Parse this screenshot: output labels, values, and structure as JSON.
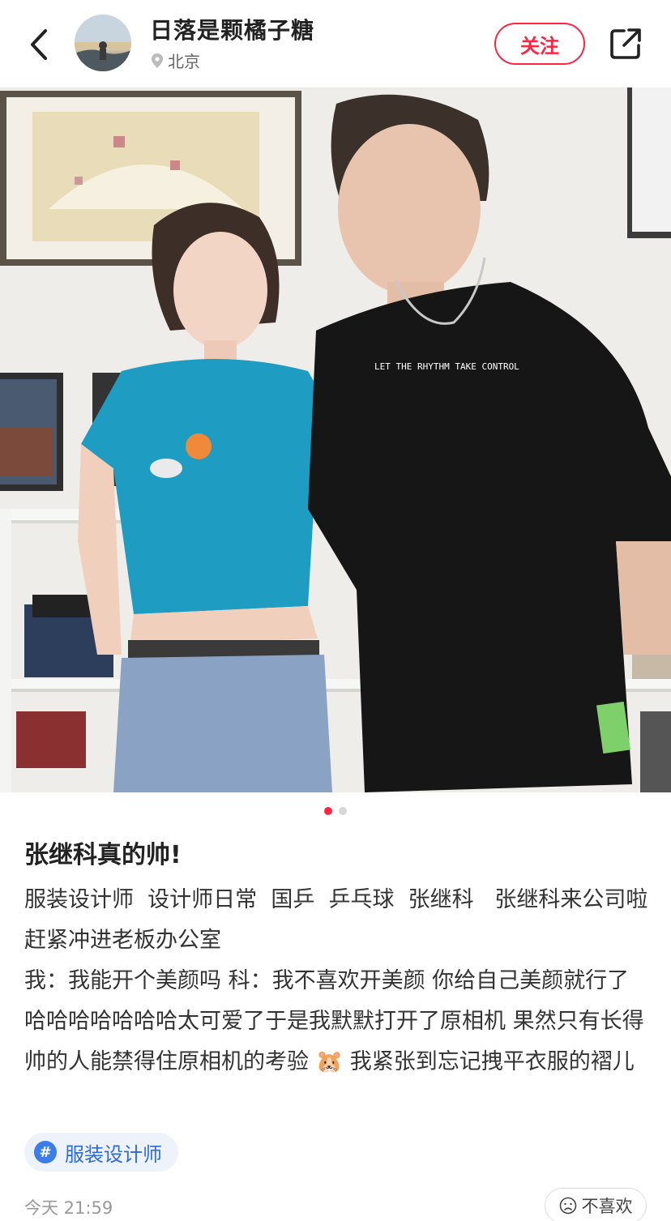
{
  "header": {
    "author_name": "日落是颗橘子糖",
    "location": "北京",
    "follow_label": "关注",
    "icons": [
      "back-icon",
      "location-pin-icon",
      "share-icon"
    ]
  },
  "post": {
    "carousel": {
      "total": 2,
      "current": 1
    },
    "image_shirt_text": "LET THE RHYTHM TAKE CONTROL",
    "title": "张继科真的帅!",
    "body": "服装设计师  设计师日常  国乒  乒乓球  张继科   张继科来公司啦 赶紧冲进老板办公室\n我：我能开个美颜吗 科：我不喜欢开美颜 你给自己美颜就行了  哈哈哈哈哈哈哈太可爱了于是我默默打开了原相机 果然只有长得帅的人能禁得住原相机的考验 🐹 我紧张到忘记拽平衣服的褶儿",
    "tag": {
      "icon": "#",
      "label": "服装设计师"
    },
    "time": "今天 21:59",
    "dislike_label": "不喜欢"
  },
  "colors": {
    "accent": "#ff2442",
    "tag_blue": "#3d7de8"
  }
}
